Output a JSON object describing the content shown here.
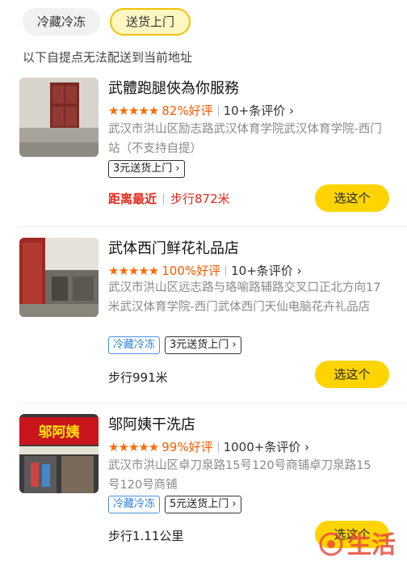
{
  "tabs": [
    {
      "label": "冷藏冷冻",
      "active": false
    },
    {
      "label": "送货上门",
      "active": true
    }
  ],
  "notice": "以下自提点无法配送到当前地址",
  "stores": [
    {
      "name": "武體跑腿俠為你服務",
      "stars": "★★★★★",
      "rating_level": 4.5,
      "good_rate": "82%好评",
      "reviews": "10+条评价",
      "address": "武汉市洪山区励志路武汉体育学院武汉体育学院-西门站（不支持自提）",
      "tags": [
        "3元送货上门"
      ],
      "nearest": "距离最近",
      "distance": "步行872米",
      "button": "选这个"
    },
    {
      "name": "武体西门鲜花礼品店",
      "stars": "★★★★★",
      "rating_level": 5,
      "good_rate": "100%好评",
      "reviews": "10+条评价",
      "address": "武汉市洪山区远志路与珞喻路辅路交叉口正北方向17米武汉体育学院-西门武体西门天仙电脑花卉礼品店",
      "tags": [
        "冷藏冷冻",
        "3元送货上门"
      ],
      "distance": "步行991米",
      "button": "选这个"
    },
    {
      "name": "邬阿姨干洗店",
      "stars": "★★★★★",
      "rating_level": 5,
      "good_rate": "99%好评",
      "reviews": "1000+条评价",
      "address": "武汉市洪山区卓刀泉路15号120号商铺卓刀泉路15号120号商铺",
      "tags": [
        "冷藏冷冻",
        "5元送货上门"
      ],
      "distance": "步行1.11公里",
      "button": "选这个",
      "sign_text": "邬阿姨"
    }
  ],
  "watermark": "生活",
  "colors": {
    "accent": "#ffd400",
    "rating": "#ff6a00",
    "alert": "#e8261c",
    "cold_tag": "#2d7fd8"
  }
}
